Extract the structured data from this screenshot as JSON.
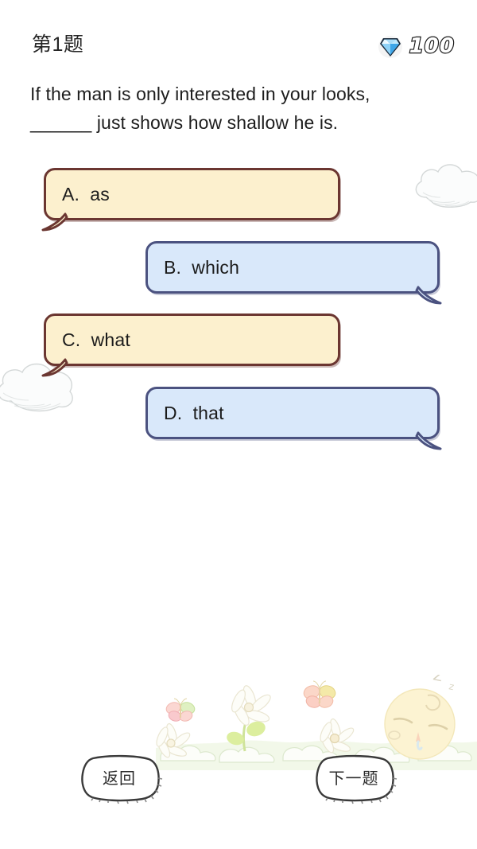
{
  "header": {
    "question_index_label": "第1题",
    "gem_icon": "diamond-gem-icon",
    "gem_count": "100"
  },
  "question": {
    "line1": "If the man is only interested in your looks,",
    "line2": "______ just shows how shallow he is."
  },
  "options": [
    {
      "key": "A",
      "label": "A.  as",
      "style": "warm",
      "align": "left",
      "tail": "bottom-left"
    },
    {
      "key": "B",
      "label": "B.  which",
      "style": "cool",
      "align": "right",
      "tail": "bottom-right"
    },
    {
      "key": "C",
      "label": "C.  what",
      "style": "warm",
      "align": "left",
      "tail": "bottom-left"
    },
    {
      "key": "D",
      "label": "D.  that",
      "style": "cool",
      "align": "right",
      "tail": "bottom-right"
    }
  ],
  "footer": {
    "back_label": "返回",
    "next_label": "下一题"
  },
  "decorations": {
    "cloud_right": "cloud-icon",
    "cloud_left": "cloud-icon",
    "sleeping_character": "sleeping-face-icon",
    "sleep_marks": "Z z",
    "butterflies": "butterfly-icon",
    "flowers": "daisy-flower-icon",
    "grass": "grass-icon"
  },
  "colors": {
    "warm_fill": "#fcf0ce",
    "warm_border": "#6b3631",
    "cool_fill": "#d9e8fa",
    "cool_border": "#4b5280",
    "page_bg": "#ffffff",
    "text": "#1b1b1b",
    "gem_blue": "#5aa9e6"
  }
}
